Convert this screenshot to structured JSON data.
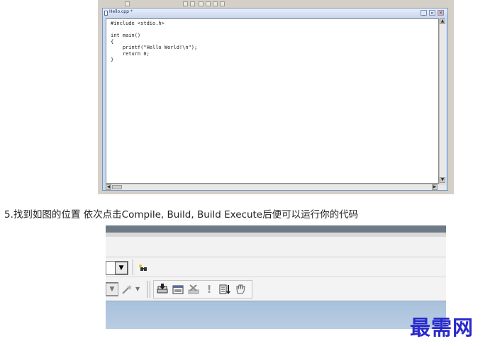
{
  "editor": {
    "tab_title": "Hello.cpp *",
    "code_lines": [
      "#include <stdio.h>",
      "",
      "int main()",
      "{",
      "    printf(\"Hello World!\\n\");",
      "    return 0;",
      "}"
    ]
  },
  "caption": {
    "text": "5.找到如图的位置 依次点击Compile, Build, Build Execute后便可以运行你的代码"
  },
  "toolbar": {
    "combo_arrow": "▼",
    "icons": [
      "binoculars-icon",
      "wand-icon",
      "compile-icon",
      "build-icon",
      "stop-build-icon",
      "execute-icon",
      "go-icon",
      "hand-icon"
    ]
  },
  "watermark": {
    "text": "最需网"
  },
  "colors": {
    "accent_blue": "#2a2acb",
    "toolbar_band": "#6e7b87",
    "taskbar_blue": "#a9c1dc"
  }
}
